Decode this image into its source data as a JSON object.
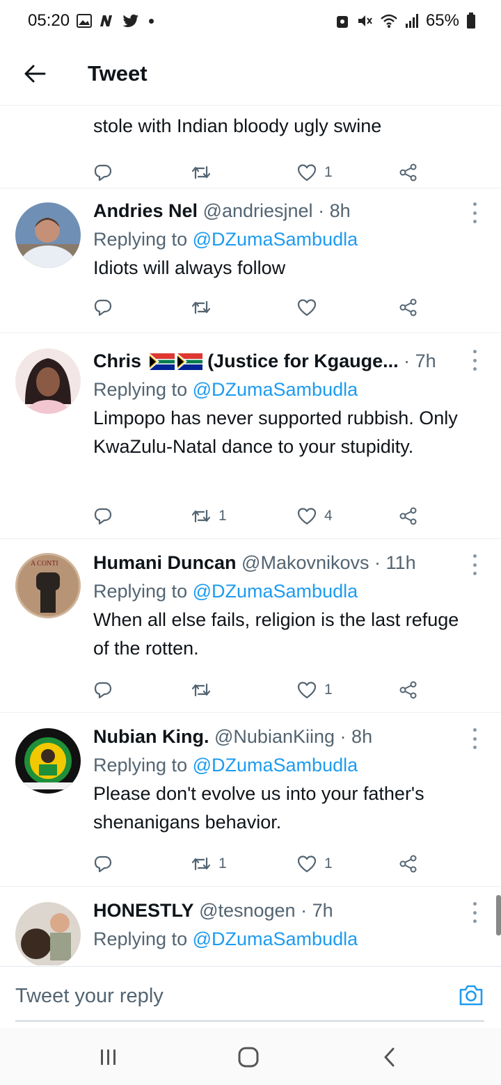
{
  "status_bar": {
    "time": "05:20",
    "battery": "65%"
  },
  "header": {
    "title": "Tweet"
  },
  "partial_tweet": {
    "text": "stole with Indian bloody ugly swine",
    "likes": "1"
  },
  "tweets": [
    {
      "display_name": "Andries Nel",
      "handle": "@andriesjnel",
      "time": "8h",
      "replying_prefix": "Replying to",
      "replying_handle": "@DZumaSambudla",
      "text": "Idiots will always follow",
      "retweets": "",
      "likes": ""
    },
    {
      "display_name": "Chris",
      "name_suffix": "(Justice for Kgauge...",
      "handle": "",
      "time": "7h",
      "replying_prefix": "Replying to",
      "replying_handle": "@DZumaSambudla",
      "text": "Limpopo has never supported rubbish. Only KwaZulu-Natal dance to your stupidity.",
      "retweets": "1",
      "likes": "4"
    },
    {
      "display_name": "Humani Duncan",
      "handle": "@Makovnikovs",
      "time": "11h",
      "replying_prefix": "Replying to",
      "replying_handle": "@DZumaSambudla",
      "text": "When all else fails, religion is the last refuge of the rotten.",
      "retweets": "",
      "likes": "1"
    },
    {
      "display_name": "Nubian King.",
      "handle": "@NubianKiing",
      "time": "8h",
      "replying_prefix": "Replying to",
      "replying_handle": "@DZumaSambudla",
      "text": "Please don't evolve us into your  father's shenanigans behavior.",
      "retweets": "1",
      "likes": "1"
    },
    {
      "display_name": "HONESTLY",
      "handle": "@tesnogen",
      "time": "7h",
      "replying_prefix": "Replying to",
      "replying_handle": "@DZumaSambudla",
      "text": "",
      "retweets": "",
      "likes": ""
    }
  ],
  "reply_bar": {
    "placeholder": "Tweet your reply"
  },
  "colors": {
    "link_blue": "#1d9bf0",
    "secondary_text": "#536471",
    "divider": "#eceff1"
  },
  "icons": [
    "back-arrow-icon",
    "reply-icon",
    "retweet-icon",
    "like-icon",
    "share-icon",
    "more-icon",
    "camera-icon",
    "recents-icon",
    "home-icon",
    "back-nav-icon"
  ]
}
